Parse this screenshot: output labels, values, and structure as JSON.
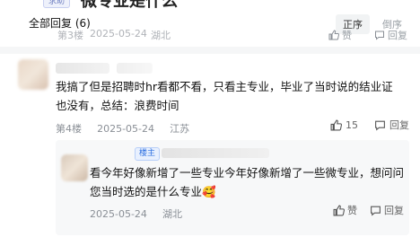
{
  "help_badge": "求助",
  "post_title": "微专业是什么",
  "replies": {
    "title": "全部回复 (6)",
    "sort": [
      "正序",
      "倒序"
    ]
  },
  "faded_row": {
    "floor": "第3楼",
    "date": "2025-05-24",
    "location": "湖北",
    "like_label": "赞",
    "reply_label": "回复"
  },
  "comment": {
    "text": "我搞了但是招聘时hr看都不看，只看主专业，毕业了当时说的结业证也没有，总结：浪费时间",
    "floor": "第4楼",
    "date": "2025-05-24",
    "location": "江苏",
    "like_count": "15",
    "reply_label": "回复"
  },
  "sub_reply": {
    "badge": "楼主",
    "text": "看今年好像新增了一些专业今年好像新增了一些微专业，想问问您当时选的是什么专业",
    "emoji": "🥰",
    "date": "2025-05-24",
    "location": "湖北",
    "like_label": "赞",
    "reply_label": "回复"
  }
}
